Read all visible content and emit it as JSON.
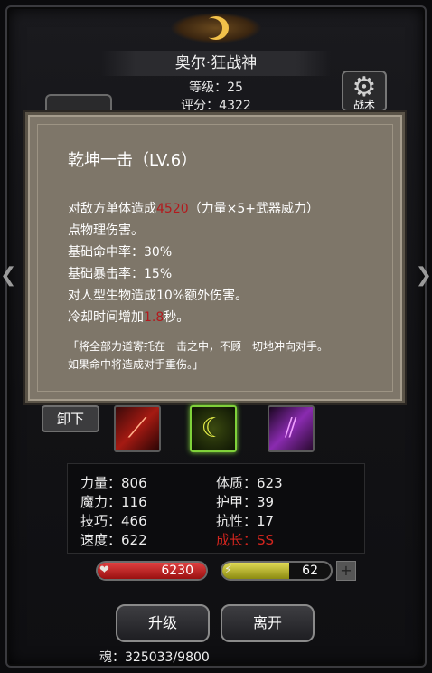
{
  "header": {
    "character_name": "奥尔·狂战神",
    "level": "等级：25",
    "score": "评分：4322",
    "tactics_label": "战术"
  },
  "tooltip": {
    "skill_name": "乾坤一击（LV.6）",
    "desc_line1_prefix": "对敌方单体造成",
    "damage_value": "4520",
    "desc_line1_suffix": "（力量×5+武器威力）",
    "desc_line2": "点物理伤害。",
    "desc_line3": "基础命中率：30%",
    "desc_line4": "基础暴击率：15%",
    "desc_line5": "对人型生物造成10%额外伤害。",
    "desc_line6_prefix": "冷却时间增加",
    "cooldown_value": "1.8",
    "desc_line6_suffix": "秒。",
    "flavor_line1": "「将全部力道寄托在一击之中，不顾一切地冲向对手。",
    "flavor_line2": "如果命中将造成对手重伤。」"
  },
  "skills": {
    "unequip_label": "卸下",
    "slots": [
      "red-slash-skill-icon",
      "green-crescent-skill-icon",
      "purple-claw-skill-icon"
    ]
  },
  "stats": {
    "strength": "力量：806",
    "magic": "魔力：116",
    "skill": "技巧：466",
    "speed": "速度：622",
    "constitution": "体质：623",
    "armor": "护甲：39",
    "resistance": "抗性：17",
    "growth": "成长：SS"
  },
  "bars": {
    "hp_value": "6230",
    "hp_fraction": 1.0,
    "mp_value": "62",
    "mp_fraction": 0.62,
    "plus_label": "+"
  },
  "actions": {
    "upgrade_label": "升级",
    "leave_label": "离开"
  },
  "soul": "魂：325033/9800",
  "colors": {
    "highlight_red": "#b3191d",
    "growth_red": "#d2251e",
    "tooltip_bg": "#7e7669"
  }
}
